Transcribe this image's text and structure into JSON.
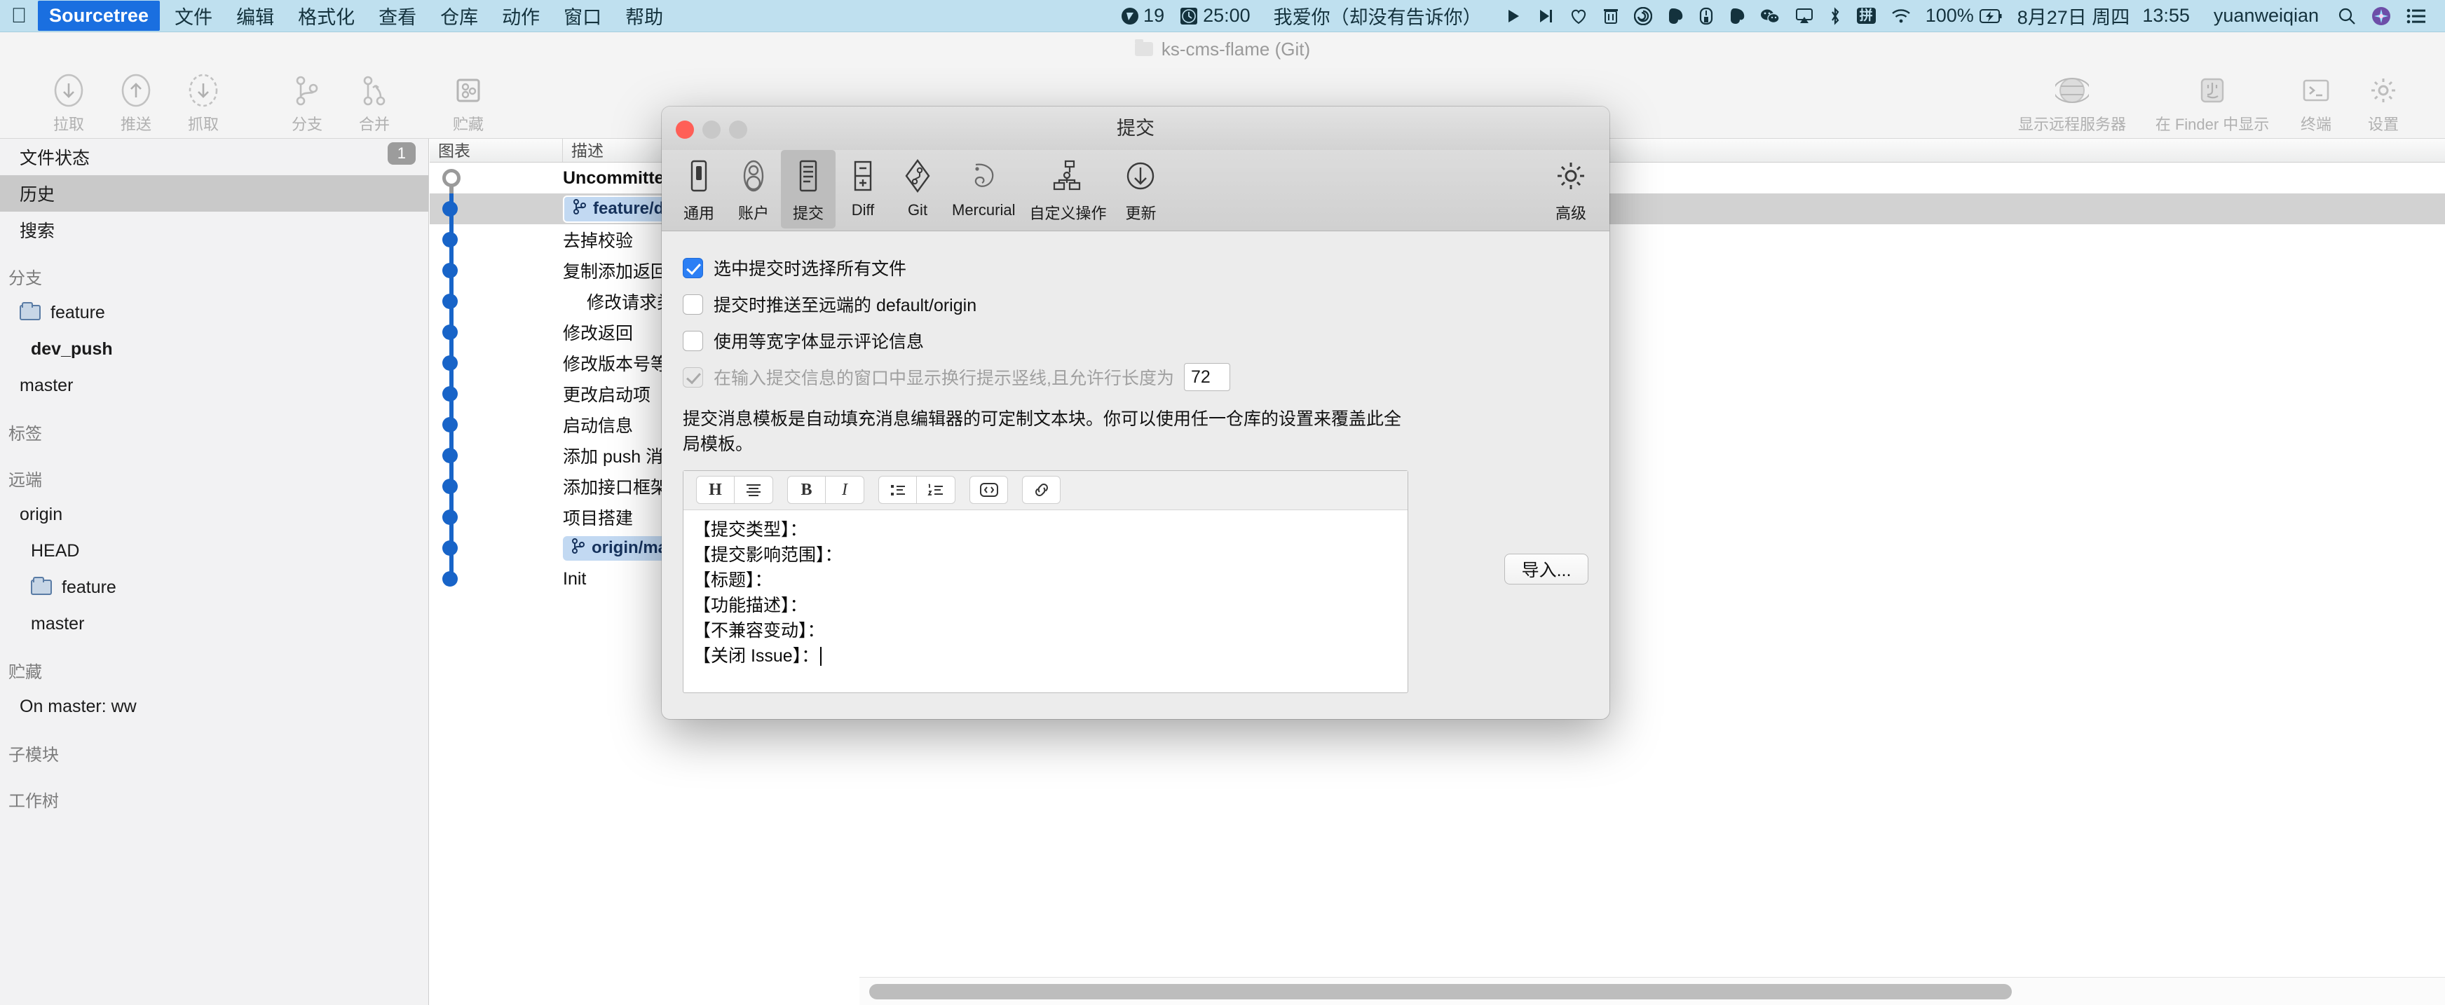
{
  "menubar": {
    "apple": "apple-logo",
    "app_name": "Sourcetree",
    "items": [
      "文件",
      "编辑",
      "格式化",
      "查看",
      "仓库",
      "动作",
      "窗口",
      "帮助"
    ],
    "status": {
      "bandwidth": "19",
      "timer": "25:00",
      "now_playing": "我爱你（却没有告诉你）",
      "battery": "100%",
      "date": "8月27日 周四",
      "time": "13:55",
      "user": "yuanweiqian",
      "ime": "拼"
    },
    "icons": [
      "download-arrow-icon",
      "stopwatch-icon",
      "play-icon",
      "next-track-icon",
      "heart-icon",
      "trash-icon",
      "spiral-music-icon",
      "evernote-icon",
      "bartender-icon",
      "evernote-icon-2",
      "wechat-icon",
      "airplay-icon",
      "bluetooth-icon",
      "ime-icon",
      "wifi-icon",
      "battery-icon",
      "search-icon",
      "siri-icon",
      "control-center-icon"
    ]
  },
  "window": {
    "title": "ks-cms-flame (Git)",
    "toolbar_left": [
      {
        "label": "拉取",
        "icon": "pull-icon"
      },
      {
        "label": "推送",
        "icon": "push-icon"
      },
      {
        "label": "抓取",
        "icon": "fetch-icon"
      },
      {
        "label": "分支",
        "icon": "branch-icon"
      },
      {
        "label": "合并",
        "icon": "merge-icon"
      },
      {
        "label": "贮藏",
        "icon": "stash-icon"
      }
    ],
    "toolbar_right": [
      {
        "label": "显示远程服务器",
        "icon": "globe-icon"
      },
      {
        "label": "在 Finder 中显示",
        "icon": "finder-icon"
      },
      {
        "label": "终端",
        "icon": "terminal-icon"
      },
      {
        "label": "设置",
        "icon": "gear-icon"
      }
    ]
  },
  "sidebar": {
    "badge": "1",
    "rows": [
      {
        "label": "文件状态",
        "type": "item",
        "selected": false
      },
      {
        "label": "历史",
        "type": "item",
        "selected": true
      },
      {
        "label": "搜索",
        "type": "item",
        "selected": false
      },
      {
        "label": "分支",
        "type": "group"
      },
      {
        "label": "feature",
        "type": "folder"
      },
      {
        "label": "dev_push",
        "type": "child-bold"
      },
      {
        "label": "master",
        "type": "child"
      },
      {
        "label": "标签",
        "type": "group"
      },
      {
        "label": "远端",
        "type": "group"
      },
      {
        "label": "origin",
        "type": "item"
      },
      {
        "label": "HEAD",
        "type": "child"
      },
      {
        "label": "feature",
        "type": "child-folder"
      },
      {
        "label": "master",
        "type": "child"
      },
      {
        "label": "贮藏",
        "type": "group"
      },
      {
        "label": "On master: ww",
        "type": "item"
      },
      {
        "label": "子模块",
        "type": "group"
      },
      {
        "label": "工作树",
        "type": "group"
      }
    ]
  },
  "commit_list": {
    "columns": [
      "图表",
      "描述"
    ],
    "rows": [
      {
        "message": "Uncommitted changes",
        "bold": true,
        "node": "hollow",
        "indent": false,
        "tag": null,
        "selected": false
      },
      {
        "message": "",
        "bold": false,
        "node": "solid",
        "indent": false,
        "tag": "feature/dev_push",
        "selected": true
      },
      {
        "message": "去掉校验",
        "bold": false,
        "node": "solid",
        "indent": false,
        "tag": null,
        "selected": false
      },
      {
        "message": "复制添加返回",
        "bold": false,
        "node": "solid",
        "indent": false,
        "tag": null,
        "selected": false
      },
      {
        "message": "修改请求类型",
        "bold": false,
        "node": "solid",
        "indent": true,
        "tag": null,
        "selected": false
      },
      {
        "message": "修改返回",
        "bold": false,
        "node": "solid",
        "indent": false,
        "tag": null,
        "selected": false
      },
      {
        "message": "修改版本号等",
        "bold": false,
        "node": "solid",
        "indent": false,
        "tag": null,
        "selected": false
      },
      {
        "message": "更改启动项",
        "bold": false,
        "node": "solid",
        "indent": false,
        "tag": null,
        "selected": false
      },
      {
        "message": "启动信息",
        "bold": false,
        "node": "solid",
        "indent": false,
        "tag": null,
        "selected": false
      },
      {
        "message": "添加 push 消息",
        "bold": false,
        "node": "solid",
        "indent": false,
        "tag": null,
        "selected": false
      },
      {
        "message": "添加接口框架",
        "bold": false,
        "node": "solid",
        "indent": false,
        "tag": null,
        "selected": false
      },
      {
        "message": "项目搭建",
        "bold": false,
        "node": "solid",
        "indent": false,
        "tag": null,
        "selected": false
      },
      {
        "message": "",
        "bold": false,
        "node": "solid",
        "indent": false,
        "tag": "origin/master",
        "selected": false
      },
      {
        "message": "Init",
        "bold": false,
        "node": "solid",
        "indent": false,
        "tag": null,
        "selected": false
      }
    ]
  },
  "dialog": {
    "title": "提交",
    "tabs": [
      {
        "label": "通用",
        "icon": "general-icon",
        "active": false
      },
      {
        "label": "账户",
        "icon": "accounts-icon",
        "active": false
      },
      {
        "label": "提交",
        "icon": "commit-icon",
        "active": true
      },
      {
        "label": "Diff",
        "icon": "diff-icon",
        "active": false
      },
      {
        "label": "Git",
        "icon": "git-icon",
        "active": false
      },
      {
        "label": "Mercurial",
        "icon": "mercurial-icon",
        "active": false
      },
      {
        "label": "自定义操作",
        "icon": "custom-actions-icon",
        "active": false
      },
      {
        "label": "更新",
        "icon": "updates-icon",
        "active": false
      }
    ],
    "advanced_tab": {
      "label": "高级",
      "icon": "gear-icon"
    },
    "options": [
      {
        "label": "选中提交时选择所有文件",
        "checked": true,
        "disabled": false
      },
      {
        "label": "提交时推送至远端的 default/origin",
        "checked": false,
        "disabled": false
      },
      {
        "label": "使用等宽字体显示评论信息",
        "checked": false,
        "disabled": false
      },
      {
        "label": "在输入提交信息的窗口中显示换行提示竖线,且允许行长度为",
        "checked": true,
        "disabled": true
      }
    ],
    "wrap_width": "72",
    "template_description": "提交消息模板是自动填充消息编辑器的可定制文本块。你可以使用任一仓库的设置来覆盖此全局模板。",
    "import_label": "导入...",
    "editor_buttons": [
      {
        "group": 0,
        "icon": "heading-icon",
        "label": "H"
      },
      {
        "group": 0,
        "icon": "align-icon",
        "label": ""
      },
      {
        "group": 1,
        "icon": "bold-icon",
        "label": "B"
      },
      {
        "group": 1,
        "icon": "italic-icon",
        "label": "I"
      },
      {
        "group": 2,
        "icon": "bullet-list-icon",
        "label": ""
      },
      {
        "group": 2,
        "icon": "numbered-list-icon",
        "label": ""
      },
      {
        "group": 3,
        "icon": "code-icon",
        "label": ""
      },
      {
        "group": 4,
        "icon": "link-icon",
        "label": ""
      }
    ],
    "template_lines": [
      "【提交类型】：",
      "【提交影响范围】：",
      "【标题】：",
      "【功能描述】：",
      "【不兼容变动】：",
      "【关闭 Issue】："
    ]
  },
  "colors": {
    "menubar_bg": "#bfe0ef",
    "app_accent": "#1a6fe0",
    "checkbox_blue": "#2b7ff5",
    "graph_node": "#1864c8",
    "ref_tag_bg": "#c2d9f2",
    "selection": "#d2d2d2"
  }
}
